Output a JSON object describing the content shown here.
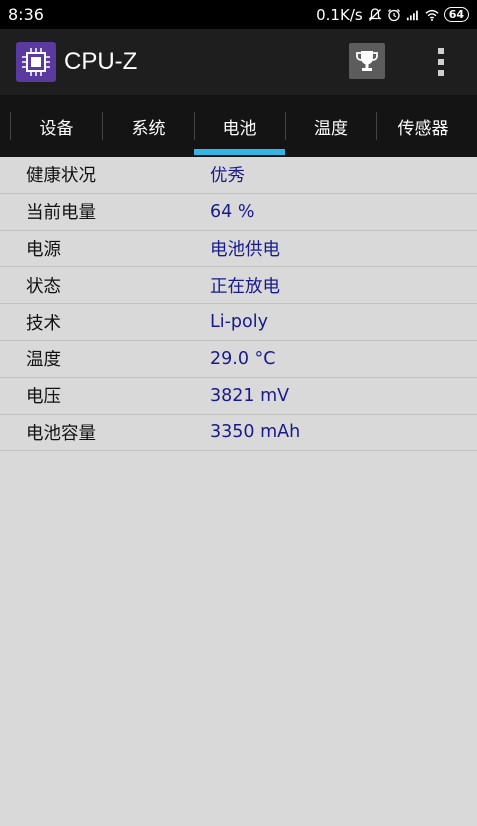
{
  "status_bar": {
    "time": "8:36",
    "network_speed": "0.1K/s",
    "battery_level": "64"
  },
  "app_bar": {
    "title": "CPU-Z"
  },
  "tabs": [
    {
      "label": "设备",
      "selected": false
    },
    {
      "label": "系统",
      "selected": false
    },
    {
      "label": "电池",
      "selected": true
    },
    {
      "label": "温度",
      "selected": false
    },
    {
      "label": "传感器",
      "selected": false
    }
  ],
  "battery_info": [
    {
      "label": "健康状况",
      "value": "优秀"
    },
    {
      "label": "当前电量",
      "value": "64 %"
    },
    {
      "label": "电源",
      "value": "电池供电"
    },
    {
      "label": "状态",
      "value": "正在放电"
    },
    {
      "label": "技术",
      "value": "Li-poly"
    },
    {
      "label": "温度",
      "value": "29.0 °C"
    },
    {
      "label": "电压",
      "value": "3821 mV"
    },
    {
      "label": "电池容量",
      "value": "3350 mAh"
    }
  ],
  "colors": {
    "accent": "#33b5e5",
    "value_text": "#1a1a8a",
    "background": "#d9d9d9"
  }
}
